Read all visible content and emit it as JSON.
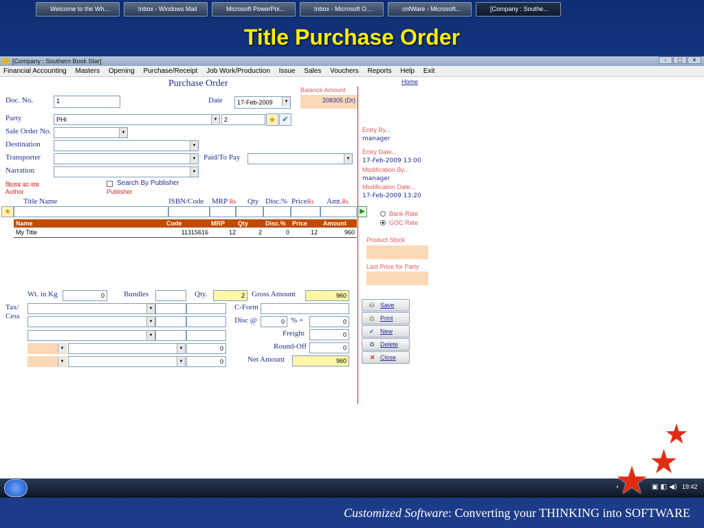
{
  "slide": {
    "title": "Title Purchase Order",
    "tagline_italic": "Customized Software",
    "tagline_rest": ":   Converting your THINKING into SOFTWARE"
  },
  "window": {
    "title": "[Company : Southern Book Star]",
    "menu": [
      "Financial Accounting",
      "Masters",
      "Opening",
      "Purchase/Receipt",
      "Job Work/Production",
      "Issue",
      "Sales",
      "Vouchers",
      "Reports",
      "Help",
      "Exit"
    ]
  },
  "form": {
    "heading": "Purchase Order",
    "home_link": "Home",
    "balance_label": "Balance Amount",
    "balance_value": "208305 (Dr)",
    "doc_no_label": "Doc. No.",
    "doc_no_value": "1",
    "date_label": "Date",
    "date_value": "17-Feb-2009",
    "party_label": "Party",
    "party_value": "PHI",
    "party_code": "2",
    "sale_order_label": "Sale Order No.",
    "destination_label": "Destination",
    "transporter_label": "Transporter",
    "paid_to_pay_label": "Paid/To Pay",
    "narration_label": "Narration",
    "hindi_label": "किताब का नाम",
    "author_label": "Author",
    "search_by_publisher": "Search By Publisher",
    "publisher_label": "Publisher"
  },
  "entry_cols": {
    "title": "Title Name",
    "isbn": "ISBN/Code",
    "mrp": "MRP",
    "rs": "Rs",
    "qty": "Qty",
    "disc": "Disc.%",
    "price": "Price",
    "amt": "Amt."
  },
  "table": {
    "headers": [
      "Name",
      "Code",
      "MRP",
      "Qty",
      "Disc.%",
      "Price",
      "Amount"
    ],
    "rows": [
      [
        "My Title",
        "11315616",
        "12",
        "2",
        "0",
        "12",
        "960"
      ]
    ]
  },
  "audit": {
    "entry_by_label": "Entry  By...",
    "entry_by_value": "manager",
    "entry_date_label": "Entry  Date...",
    "entry_date_value": "17-Feb-2009 13:00",
    "mod_by_label": "Modification  By...",
    "mod_by_value": "manager",
    "mod_date_label": "Modification  Date...",
    "mod_date_value": "17-Feb-2009 13:20"
  },
  "rates": {
    "bank": "Bank Rate",
    "goc": "GOC Rate",
    "selected": "goc"
  },
  "stock": {
    "product_stock_label": "Product Stock",
    "last_price_label": "Last Price for Party"
  },
  "totals": {
    "wt_label": "Wt. in Kg",
    "wt_value": "0",
    "bundles_label": "Bundles",
    "qty_label": "Qty.",
    "qty_value": "2",
    "gross_label": "Gross Amount",
    "gross_value": "960",
    "tax_label": "Tax/",
    "cess_label": "Cess",
    "cform_label": "C-Form",
    "disc_label": "Disc @",
    "disc_pct": "0",
    "pct_eq": "% =",
    "disc_value": "0",
    "freight_label": "Freight",
    "freight_value": "0",
    "roundoff_label": "Round-Off",
    "roundoff_value": "0",
    "net_label": "Net Amount",
    "net_value": "960",
    "tax_row4_value": "0",
    "tax_row5_value": "0"
  },
  "buttons": {
    "save": "Save",
    "print": "Print",
    "new": "New",
    "delete": "Delete",
    "close": "Close"
  },
  "taskbar": {
    "items": [
      "Welcome to the Wh...",
      "Inbox - Windows Mail",
      "Microsoft PowerPoi...",
      "Inbox - Microsoft O...",
      "cnfWare - Microsoft...",
      "[Company : Southe..."
    ],
    "clock": "19:42"
  },
  "colors": {
    "accent_red": "#c04a00",
    "title_yellow": "#ffee00",
    "star_red": "#e02d12"
  }
}
